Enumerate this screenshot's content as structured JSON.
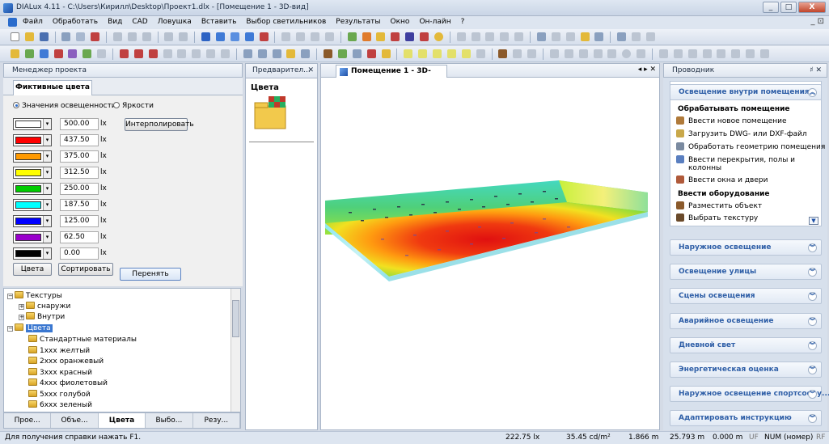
{
  "window": {
    "title": "DIALux 4.11 - C:\\Users\\Кирилл\\Desktop\\Проект1.dlx - [Помещение 1 - 3D-вид]",
    "min": "_",
    "max": "□",
    "close": "X"
  },
  "menu": {
    "items": [
      "Файл",
      "Обработать",
      "Вид",
      "CAD",
      "Ловушка",
      "Вставить",
      "Выбор светильников",
      "Результаты",
      "Окно",
      "Он-лайн",
      "?"
    ],
    "right": "_ ⊡"
  },
  "left_panel": {
    "header": "Менеджер проекта",
    "tab": "Фиктивные цвета",
    "radio_illuminance": "Значения освещенности",
    "radio_luminance": "Яркости",
    "interpolate_button": "Интерполировать",
    "unit": "lx",
    "rows": [
      {
        "value": "500.00",
        "color": "#ffffff"
      },
      {
        "value": "437.50",
        "color": "#ff0000"
      },
      {
        "value": "375.00",
        "color": "#ff9900"
      },
      {
        "value": "312.50",
        "color": "#ffff00"
      },
      {
        "value": "250.00",
        "color": "#00cc00"
      },
      {
        "value": "187.50",
        "color": "#00ffff"
      },
      {
        "value": "125.00",
        "color": "#0000ff"
      },
      {
        "value": "62.50",
        "color": "#9900cc"
      },
      {
        "value": "0.00",
        "color": "#000000"
      }
    ],
    "colors_button": "Цвета",
    "sort_button": "Сортировать",
    "apply_button": "Перенять"
  },
  "tree": {
    "textures": "Текстуры",
    "outside": "снаружи",
    "inside": "Внутри",
    "colors": "Цвета",
    "items": [
      "Стандартные материалы",
      "1ххх желтый",
      "2ххх оранжевый",
      "3ххх красный",
      "4ххх фиолетовый",
      "5ххх голубой",
      "6ххх зеленый"
    ]
  },
  "left_tabs": [
    "Прое...",
    "Объе...",
    "Цвета",
    "Выбо...",
    "Резу..."
  ],
  "preview": {
    "header": "Предварител...",
    "pin": "✕",
    "label": "Цвета"
  },
  "view": {
    "tab": "Помещение 1 - 3D-вид",
    "nav": "◂ ▸ ✕"
  },
  "right_panel": {
    "header": "Проводник",
    "pin": "♯ ✕",
    "section_open": "Освещение внутри помещения",
    "group1_title": "Обрабатывать помещение",
    "group1_items": [
      "Ввести новое помещение",
      "Загрузить DWG- или DXF-файл",
      "Обработать геометрию помещения",
      "Ввести перекрытия, полы и",
      "колонны",
      "Ввести окна и двери"
    ],
    "group2_title": "Ввести оборудование",
    "group2_items": [
      "Разместить объект",
      "Выбрать текстуру"
    ],
    "sections": [
      "Наружное освещение",
      "Освещение улицы",
      "Сцены освещения",
      "Аварийное освещение",
      "Дневной свет",
      "Энергетическая оценка",
      "Наружное освещение спортсоору...",
      "Адаптировать инструкцию"
    ]
  },
  "status": {
    "help": "Для получения справки нажать F1.",
    "lux": "222.75 lx",
    "lum": "35.45 cd/m²",
    "x": "1.866 m",
    "y": "25.793 m",
    "z": "0.000 m",
    "uf": "UF",
    "num": "NUM (номер)",
    "rf": "RF"
  }
}
